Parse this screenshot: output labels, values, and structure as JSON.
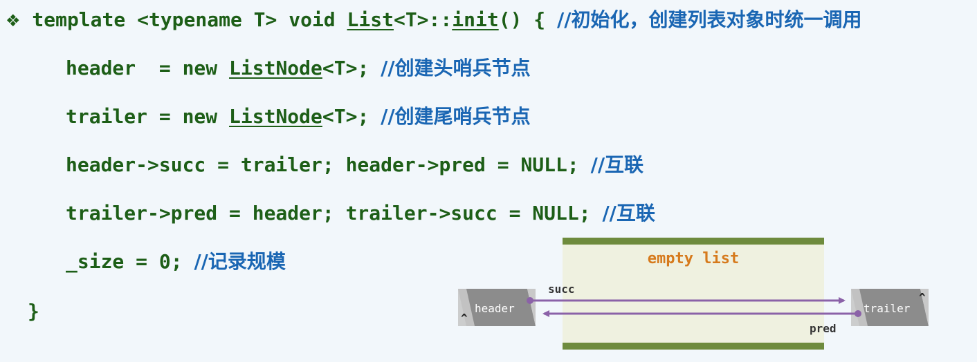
{
  "code": {
    "bullet": "❖",
    "line1": {
      "pre": "template <typename T> void ",
      "list": "List",
      "mid": "<T>::",
      "init": "init",
      "post": "() { ",
      "comment": "//初始化，创建列表对象时统一调用"
    },
    "line2": {
      "pre": "header  = new ",
      "type": "ListNode",
      "post": "<T>; ",
      "comment": "//创建头哨兵节点"
    },
    "line3": {
      "pre": "trailer = new ",
      "type": "ListNode",
      "post": "<T>; ",
      "comment": "//创建尾哨兵节点"
    },
    "line4": {
      "code": "header->succ = trailer; header->pred = NULL; ",
      "comment": "//互联"
    },
    "line5": {
      "code": "trailer->pred = header; trailer->succ = NULL; ",
      "comment": "//互联"
    },
    "line6": {
      "code": "_size = 0; ",
      "comment": "//记录规模"
    },
    "line7": {
      "code": "}"
    }
  },
  "diagram": {
    "title": "empty list",
    "header_label": "header",
    "trailer_label": "trailer",
    "header_caret": "^",
    "trailer_caret": "^",
    "succ_label": "succ",
    "pred_label": "pred",
    "colors": {
      "panel": "#eff1e0",
      "bar": "#6e8b3d",
      "title": "#d67a1c",
      "node": "#8c8c8c",
      "arrow": "#8b62a8"
    }
  }
}
